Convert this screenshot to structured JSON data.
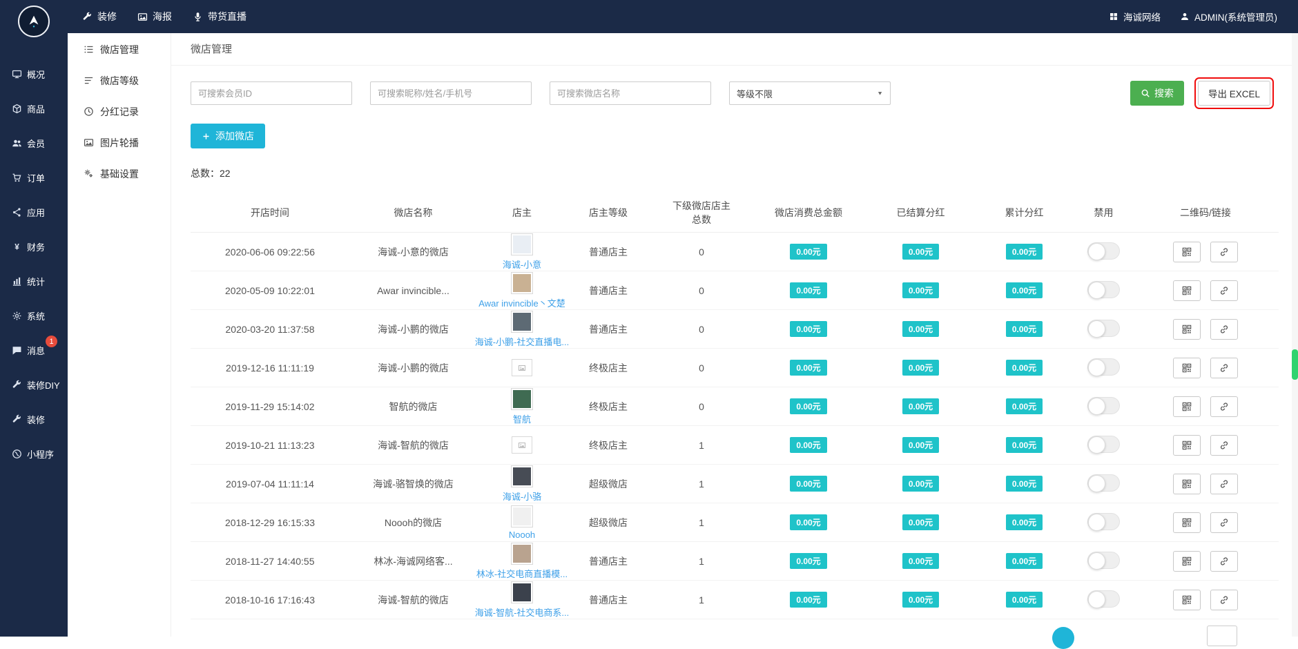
{
  "colors": {
    "topbar_bg": "#1b2a47",
    "accent_cyan": "#1fb5d8",
    "badge_cyan": "#1fc3c9",
    "search_green": "#4caf50",
    "link_blue": "#3ea0e8",
    "highlight_red": "#f00b0b",
    "message_badge_red": "#e74c3c",
    "scrollbar_green": "#2fd36f"
  },
  "topbar": {
    "nav": [
      {
        "name": "fitment",
        "label": "装修",
        "icon": "brush"
      },
      {
        "name": "poster",
        "label": "海报",
        "icon": "image"
      },
      {
        "name": "live-selling",
        "label": "带货直播",
        "icon": "live"
      }
    ],
    "right": [
      {
        "name": "network",
        "label": "海诚网络",
        "icon": "grid"
      },
      {
        "name": "admin-account",
        "label": "ADMIN(系统管理员)",
        "icon": "user"
      }
    ]
  },
  "sidebar": {
    "items": [
      {
        "name": "overview",
        "label": "概况",
        "icon": "overview"
      },
      {
        "name": "goods",
        "label": "商品",
        "icon": "goods"
      },
      {
        "name": "members",
        "label": "会员",
        "icon": "members"
      },
      {
        "name": "orders",
        "label": "订单",
        "icon": "orders"
      },
      {
        "name": "apps",
        "label": "应用",
        "icon": "apps"
      },
      {
        "name": "finance",
        "label": "财务",
        "icon": "finance"
      },
      {
        "name": "stats",
        "label": "统计",
        "icon": "stats"
      },
      {
        "name": "system",
        "label": "系统",
        "icon": "system"
      },
      {
        "name": "messages",
        "label": "消息",
        "icon": "message",
        "badge": "1"
      },
      {
        "name": "fitment-diy",
        "label": "装修DIY",
        "icon": "diy"
      },
      {
        "name": "fitment",
        "label": "装修",
        "icon": "fitment"
      },
      {
        "name": "miniprogram",
        "label": "小程序",
        "icon": "miniprogram"
      }
    ]
  },
  "submenu": [
    {
      "name": "shop-management",
      "label": "微店管理",
      "icon": "list"
    },
    {
      "name": "shop-level",
      "label": "微店等级",
      "icon": "level"
    },
    {
      "name": "dividend-records",
      "label": "分红记录",
      "icon": "record"
    },
    {
      "name": "image-carousel",
      "label": "图片轮播",
      "icon": "carousel"
    },
    {
      "name": "basic-settings",
      "label": "基础设置",
      "icon": "settings"
    }
  ],
  "page": {
    "breadcrumb": "微店管理",
    "filters": {
      "member_id_placeholder": "可搜索会员ID",
      "nickname_placeholder": "可搜索昵称/姓名/手机号",
      "shop_placeholder": "可搜索微店名称",
      "level_selected": "等级不限",
      "search_label": "搜索",
      "export_label": "导出 EXCEL"
    },
    "add_button_label": "添加微店",
    "total_label": "总数：22",
    "table": {
      "headers": [
        "开店时间",
        "微店名称",
        "店主",
        "店主等级",
        "下级微店店主总数",
        "微店消费总金额",
        "已结算分红",
        "累计分红",
        "禁用",
        "二维码/链接"
      ],
      "rows": [
        {
          "time": "2020-06-06 09:22:56",
          "shop": "海诚-小意的微店",
          "owner": "海诚-小意",
          "avatar": "photo",
          "avatar_color": "#e9eef4",
          "level": "普通店主",
          "count": "0",
          "consume": "0.00元",
          "settled": "0.00元",
          "dividend": "0.00元",
          "toggle_on": false
        },
        {
          "time": "2020-05-09 10:22:01",
          "shop": "Awar invincible...",
          "owner": "Awar invincible丶文楚",
          "avatar": "photo",
          "avatar_color": "#c9b193",
          "level": "普通店主",
          "count": "0",
          "consume": "0.00元",
          "settled": "0.00元",
          "dividend": "0.00元",
          "toggle_on": false
        },
        {
          "time": "2020-03-20 11:37:58",
          "shop": "海诚-小鹏的微店",
          "owner": "海诚-小鹏-社交直播电...",
          "avatar": "photo",
          "avatar_color": "#5d6a74",
          "level": "普通店主",
          "count": "0",
          "consume": "0.00元",
          "settled": "0.00元",
          "dividend": "0.00元",
          "toggle_on": false
        },
        {
          "time": "2019-12-16 11:11:19",
          "shop": "海诚-小鹏的微店",
          "owner": "",
          "avatar": "broken",
          "avatar_color": "",
          "level": "终极店主",
          "count": "0",
          "consume": "0.00元",
          "settled": "0.00元",
          "dividend": "0.00元",
          "toggle_on": false
        },
        {
          "time": "2019-11-29 15:14:02",
          "shop": "智航的微店",
          "owner": "智航",
          "avatar": "photo",
          "avatar_color": "#3f6b52",
          "level": "终极店主",
          "count": "0",
          "consume": "0.00元",
          "settled": "0.00元",
          "dividend": "0.00元",
          "toggle_on": false
        },
        {
          "time": "2019-10-21 11:13:23",
          "shop": "海诚-智航的微店",
          "owner": "",
          "avatar": "broken",
          "avatar_color": "",
          "level": "终极店主",
          "count": "1",
          "consume": "0.00元",
          "settled": "0.00元",
          "dividend": "0.00元",
          "toggle_on": false
        },
        {
          "time": "2019-07-04 11:11:14",
          "shop": "海诚-骆智焕的微店",
          "owner": "海诚-小骆",
          "avatar": "photo",
          "avatar_color": "#474c55",
          "level": "超级微店",
          "count": "1",
          "consume": "0.00元",
          "settled": "0.00元",
          "dividend": "0.00元",
          "toggle_on": false
        },
        {
          "time": "2018-12-29 16:15:33",
          "shop": "Noooh的微店",
          "owner": "Noooh",
          "avatar": "photo",
          "avatar_color": "#f0f0f0",
          "level": "超级微店",
          "count": "1",
          "consume": "0.00元",
          "settled": "0.00元",
          "dividend": "0.00元",
          "toggle_on": false
        },
        {
          "time": "2018-11-27 14:40:55",
          "shop": "林冰-海诚网络客...",
          "owner": "林冰-社交电商直播模...",
          "avatar": "photo",
          "avatar_color": "#b9a38f",
          "level": "普通店主",
          "count": "1",
          "consume": "0.00元",
          "settled": "0.00元",
          "dividend": "0.00元",
          "toggle_on": false
        },
        {
          "time": "2018-10-16 17:16:43",
          "shop": "海诚-智航的微店",
          "owner": "海诚-智航-社交电商系...",
          "avatar": "photo",
          "avatar_color": "#3b414c",
          "level": "普通店主",
          "count": "1",
          "consume": "0.00元",
          "settled": "0.00元",
          "dividend": "0.00元",
          "toggle_on": false
        }
      ]
    }
  }
}
